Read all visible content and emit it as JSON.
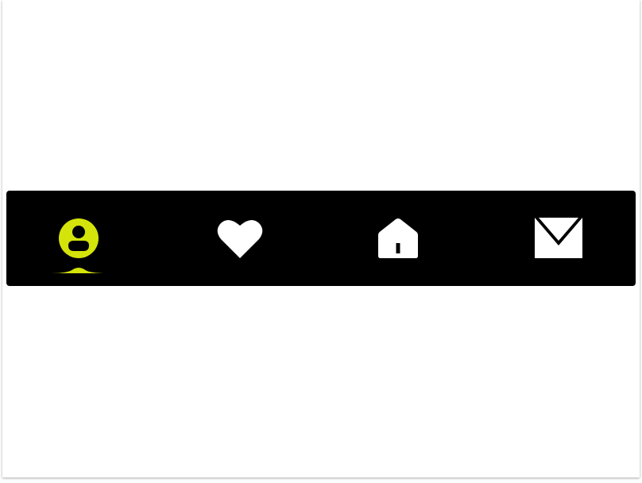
{
  "tab_bar": {
    "accent_color": "#d4e40a",
    "background_color": "#000000",
    "icon_color": "#ffffff",
    "active_index": 0,
    "tabs": [
      {
        "icon": "user-icon",
        "active": true
      },
      {
        "icon": "heart-icon",
        "active": false
      },
      {
        "icon": "home-icon",
        "active": false
      },
      {
        "icon": "mail-icon",
        "active": false
      }
    ]
  }
}
